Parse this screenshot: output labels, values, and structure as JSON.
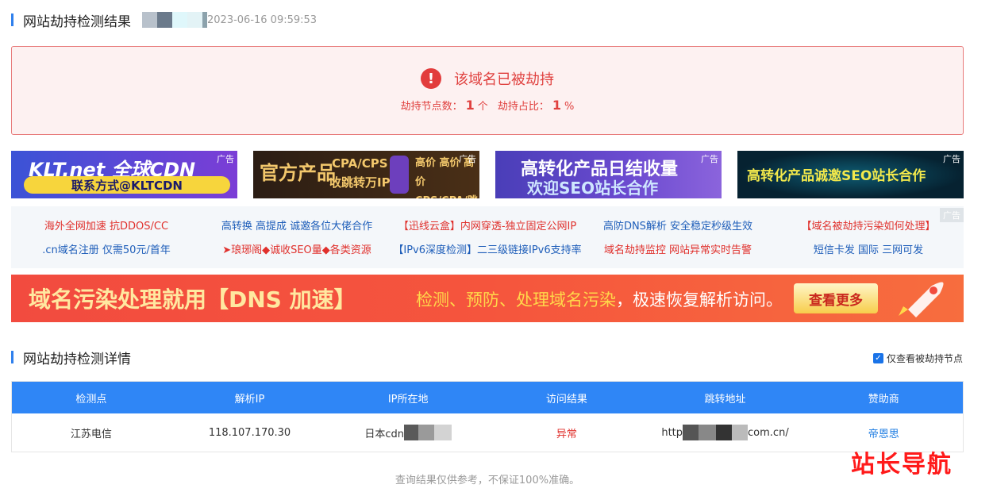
{
  "colors": {
    "accent": "#2f80ed",
    "alert": "#e0413f",
    "table_header": "#2f86f6"
  },
  "header": {
    "title": "网站劫持检测结果",
    "check_time": "2023-06-16 09:59:53",
    "masked_domain_swatches": [
      "#b8c1cb",
      "#6b7a8b",
      "#9aa8b6",
      "#dff7fb",
      "#e3f3f6",
      "#8ca2ac"
    ]
  },
  "result": {
    "icon": "exclamation-icon",
    "message": "该域名已被劫持",
    "nodes_label": "劫持节点数：",
    "nodes_count": "1",
    "nodes_unit": "个",
    "ratio_label": "劫持占比：",
    "ratio_value": "1",
    "ratio_unit": "%"
  },
  "ads": {
    "tag": "广告",
    "banner1": {
      "logo": "KLT.net 全球CDN",
      "contact": "联系方式@KLTCDN"
    },
    "banner2": {
      "left": "官方产品",
      "mid": "CPA/CPS\n收跳转万IP",
      "right": "高价 高价 高价\nCPS/CPA/跳转"
    },
    "banner3": {
      "line1": "高转化产品日结收量",
      "line2": "欢迎SEO站长合作"
    },
    "banner4": {
      "line1": "高转化产品诚邀SEO站长合作"
    }
  },
  "text_links": {
    "tag": "广告",
    "row1": [
      {
        "text": "海外全网加速 抗DDOS/CC",
        "color": "red"
      },
      {
        "text": "高转换 高提成 诚邀各位大佬合作",
        "color": "blue"
      },
      {
        "text": "【迅线云盒】内网穿透-独立固定公网IP",
        "color": "red"
      },
      {
        "text": "高防DNS解析 安全稳定秒级生效",
        "color": "blue"
      },
      {
        "text": "【域名被劫持污染如何处理】",
        "color": "red"
      }
    ],
    "row2": [
      {
        "text": ".cn域名注册 仅需50元/首年",
        "color": "blue"
      },
      {
        "text": "➤琅琊阁◆诚收SEO量◆各类资源",
        "color": "red"
      },
      {
        "text": "【IPv6深度检测】二三级链接IPv6支持率",
        "color": "blue"
      },
      {
        "text": "域名劫持监控 网站异常实时告警",
        "color": "red"
      },
      {
        "text": "短信卡发 国际 三网可发",
        "color": "blue"
      }
    ]
  },
  "big_banner": {
    "headline": "域名污染处理就用【DNS 加速】",
    "desc_highlight": "检测、预防、处理域名污染",
    "desc_rest": "，极速恢复解析访问。",
    "button": "查看更多"
  },
  "details": {
    "title": "网站劫持检测详情",
    "only_hijacked_label": "仅查看被劫持节点",
    "only_hijacked_checked": true,
    "columns": [
      "检测点",
      "解析IP",
      "IP所在地",
      "访问结果",
      "跳转地址",
      "赞助商"
    ],
    "rows": [
      {
        "location": "江苏电信",
        "ip": "118.107.170.30",
        "ip_location_prefix": "日本cdn",
        "result": "异常",
        "redirect_prefix": "http",
        "redirect_suffix": "com.cn/",
        "sponsor": "帝恩思"
      }
    ]
  },
  "footer": {
    "note": "查询结果仅供参考，不保证100%准确。"
  },
  "watermark": {
    "text": "站长导航"
  }
}
